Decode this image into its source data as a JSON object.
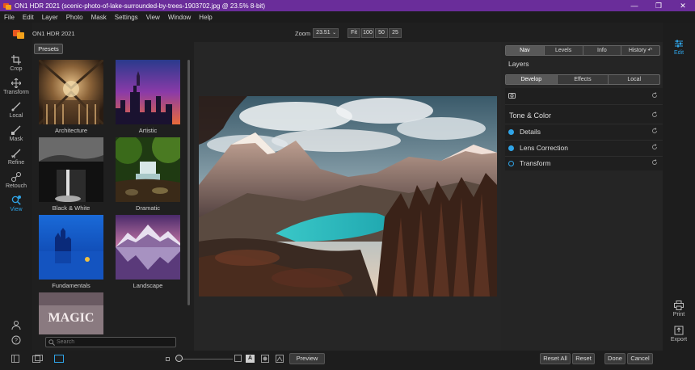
{
  "window": {
    "title": "ON1 HDR 2021 (scenic-photo-of-lake-surrounded-by-trees-1903702.jpg @ 23.5% 8-bit)",
    "controls": [
      "minimize-icon",
      "restore-icon",
      "close-icon"
    ]
  },
  "menu": [
    "File",
    "Edit",
    "Layer",
    "Photo",
    "Mask",
    "Settings",
    "View",
    "Window",
    "Help"
  ],
  "app_name": "ON1 HDR 2021",
  "tools": {
    "crop": "Crop",
    "transform": "Transform",
    "local": "Local",
    "mask": "Mask",
    "refine": "Refine",
    "retouch": "Retouch",
    "view": "View"
  },
  "zoom": {
    "label": "Zoom",
    "value": "23.51",
    "presets": [
      "Fit",
      "100",
      "50",
      "25"
    ]
  },
  "presets": {
    "tab_label": "Presets",
    "items": [
      "Architecture",
      "Artistic",
      "Black & White",
      "Dramatic",
      "Fundamentals",
      "Landscape"
    ],
    "partial_item_text": "MAGIC",
    "search_placeholder": "Search"
  },
  "right_panel": {
    "top_tabs": [
      "Nav",
      "Levels",
      "Info",
      "History"
    ],
    "layers_title": "Layers",
    "sub_tabs": [
      "Develop",
      "Effects",
      "Local"
    ],
    "section_title": "Tone & Color",
    "rows": [
      "Details",
      "Lens Correction",
      "Transform"
    ]
  },
  "right_strip": {
    "edit": "Edit",
    "print": "Print",
    "export": "Export"
  },
  "bottom": {
    "preview": "Preview",
    "reset_all": "Reset All",
    "reset": "Reset",
    "done": "Done",
    "cancel": "Cancel",
    "a_label": "A"
  },
  "colors": {
    "title_bar": "#6a2d9a",
    "accent": "#2fa4e7"
  }
}
